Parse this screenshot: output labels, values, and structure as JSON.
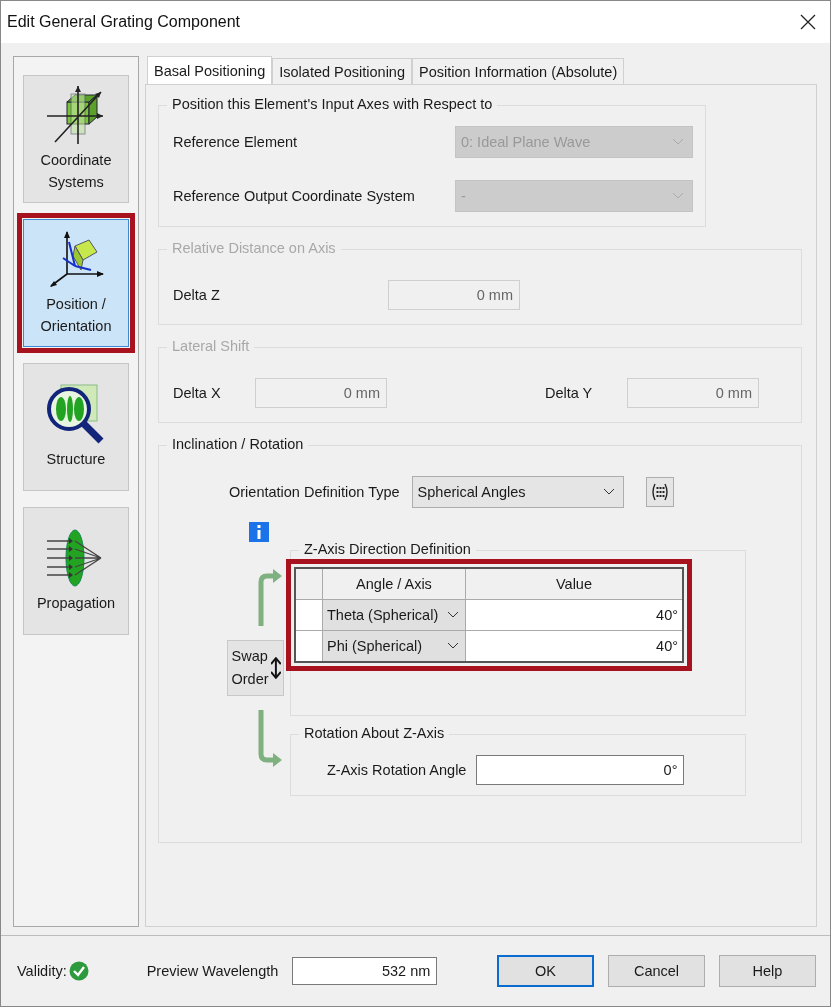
{
  "window": {
    "title": "Edit General Grating Component"
  },
  "sidebar": {
    "items": [
      {
        "label": "Coordinate Systems",
        "kind": "coordinates",
        "selected": false,
        "highlighted": false
      },
      {
        "label": "Position / Orientation",
        "kind": "orientation",
        "selected": true,
        "highlighted": true
      },
      {
        "label": "Structure",
        "kind": "structure",
        "selected": false,
        "highlighted": false
      },
      {
        "label": "Propagation",
        "kind": "propagation",
        "selected": false,
        "highlighted": false
      }
    ]
  },
  "tabs": [
    {
      "label": "Basal Positioning",
      "selected": true
    },
    {
      "label": "Isolated Positioning",
      "selected": false
    },
    {
      "label": "Position Information (Absolute)",
      "selected": false
    }
  ],
  "reference_group": {
    "title": "Position this Element's Input Axes with Respect to",
    "disabled": false,
    "fields": [
      {
        "label": "Reference Element",
        "value": "0: Ideal Plane Wave",
        "disabled": true
      },
      {
        "label": "Reference Output Coordinate System",
        "value": "-",
        "disabled": true
      }
    ]
  },
  "relative_distance_group": {
    "title": "Relative Distance on Axis",
    "disabled": true,
    "fields": [
      {
        "label": "Delta Z",
        "value": "0 mm",
        "disabled": true
      }
    ]
  },
  "lateral_shift_group": {
    "title": "Lateral Shift",
    "disabled": true,
    "fields": [
      {
        "label": "Delta X",
        "value": "0 mm",
        "disabled": true
      },
      {
        "label": "Delta Y",
        "value": "0 mm",
        "disabled": true
      }
    ]
  },
  "inclination_group": {
    "title": "Inclination / Rotation",
    "orientation_type": {
      "label": "Orientation Definition Type",
      "value": "Spherical Angles"
    },
    "z_axis_group": {
      "title": "Z-Axis Direction Definition",
      "highlighted": true,
      "columns": [
        "Angle / Axis",
        "Value"
      ],
      "rows": [
        {
          "axis": "Theta (Spherical)",
          "value": "40°"
        },
        {
          "axis": "Phi (Spherical)",
          "value": "40°"
        }
      ]
    },
    "swap_button": "Swap Order",
    "rotation_group": {
      "title": "Rotation About Z-Axis",
      "label": "Z-Axis Rotation Angle",
      "value": "0°"
    }
  },
  "footer": {
    "validity_label": "Validity:",
    "valid": true,
    "wavelength_label": "Preview Wavelength",
    "wavelength": "532 nm",
    "buttons": [
      {
        "label": "OK",
        "default": true
      },
      {
        "label": "Cancel",
        "default": false
      },
      {
        "label": "Help",
        "default": false
      }
    ]
  }
}
